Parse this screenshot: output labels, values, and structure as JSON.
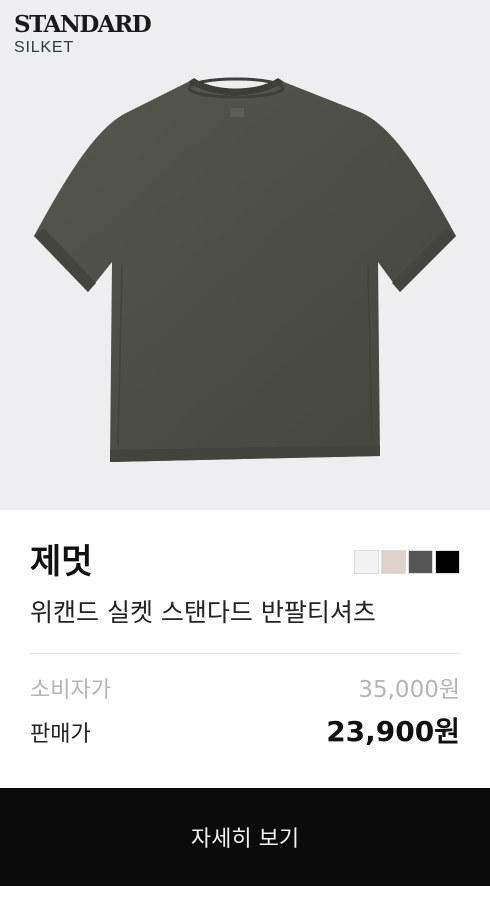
{
  "brand": {
    "line1": "STANDARD",
    "line2": "SILKET"
  },
  "product": {
    "brand_name": "제멋",
    "name": "위캔드 실켓 스탠다드 반팔티셔츠",
    "image_icon": "t-shirt-image",
    "colors": [
      "#f2f2f2",
      "#ddd3cb",
      "#555555",
      "#000000"
    ]
  },
  "pricing": {
    "msrp_label": "소비자가",
    "msrp_value": "35,000원",
    "sale_label": "판매가",
    "sale_value": "23,900원"
  },
  "cta": {
    "label": "자세히 보기"
  }
}
